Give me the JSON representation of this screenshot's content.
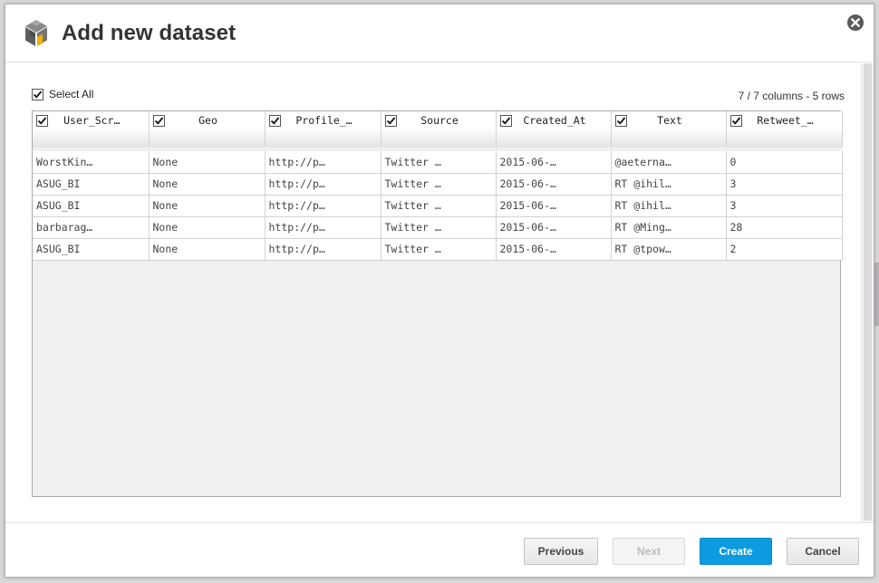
{
  "dialog": {
    "title": "Add new dataset",
    "logo_icon": "cube-stack-icon",
    "close_icon": "close-circle-icon"
  },
  "selection": {
    "select_all_label": "Select All",
    "select_all_checked": true,
    "summary": "7 / 7 columns - 5 rows"
  },
  "table": {
    "columns": [
      {
        "label": "User_Scr…",
        "checked": true
      },
      {
        "label": "Geo",
        "checked": true
      },
      {
        "label": "Profile_…",
        "checked": true
      },
      {
        "label": "Source",
        "checked": true
      },
      {
        "label": "Created_At",
        "checked": true
      },
      {
        "label": "Text",
        "checked": true
      },
      {
        "label": "Retweet_…",
        "checked": true
      }
    ],
    "rows": [
      [
        "WorstKin…",
        "None",
        "http://p…",
        "Twitter …",
        "2015-06-…",
        "@aeterna…",
        "0"
      ],
      [
        "ASUG_BI",
        "None",
        "http://p…",
        "Twitter …",
        "2015-06-…",
        "RT @ihil…",
        "3"
      ],
      [
        "ASUG_BI",
        "None",
        "http://p…",
        "Twitter …",
        "2015-06-…",
        "RT @ihil…",
        "3"
      ],
      [
        "barbarag…",
        "None",
        "http://p…",
        "Twitter …",
        "2015-06-…",
        "RT @Ming…",
        "28"
      ],
      [
        "ASUG_BI",
        "None",
        "http://p…",
        "Twitter …",
        "2015-06-…",
        "RT @tpow…",
        "2"
      ]
    ]
  },
  "footer": {
    "previous_label": "Previous",
    "next_label": "Next",
    "next_disabled": true,
    "create_label": "Create",
    "cancel_label": "Cancel"
  },
  "colors": {
    "primary_button": "#0d9be0",
    "title_text": "#333333",
    "logo_accent": "#f0b400"
  }
}
